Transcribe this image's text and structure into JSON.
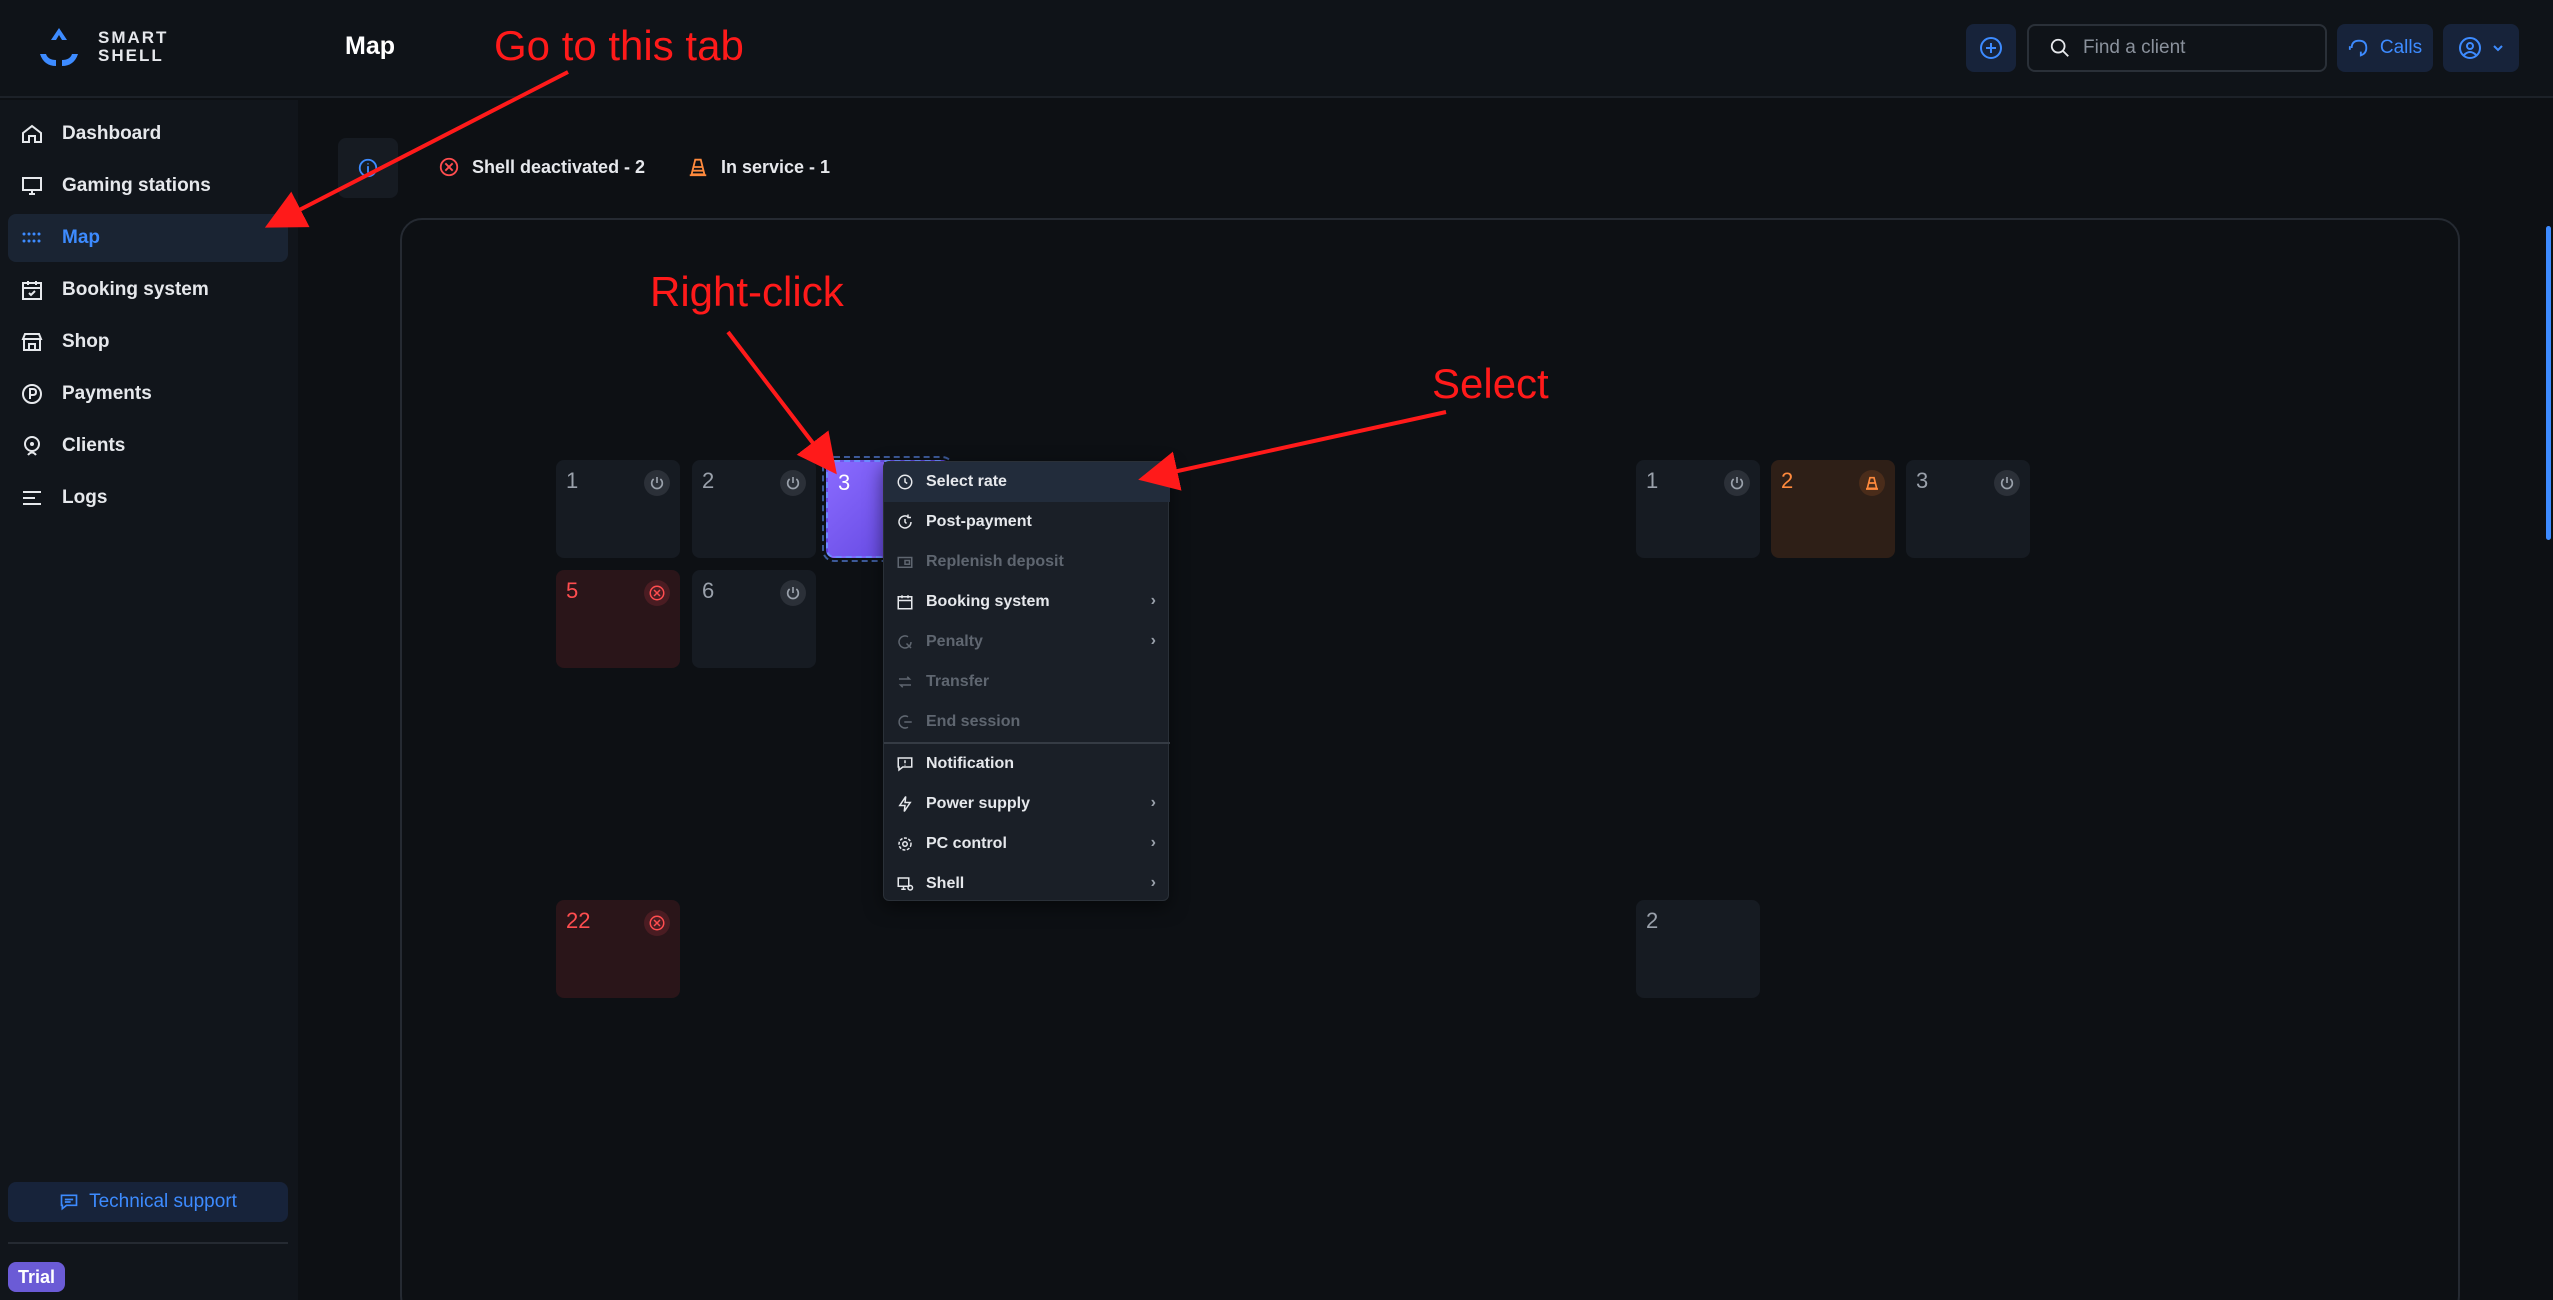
{
  "app": {
    "logo_line1": "SMART",
    "logo_line2": "SHELL",
    "page_title": "Map"
  },
  "header": {
    "search_placeholder": "Find a client",
    "calls_label": "Calls"
  },
  "sidebar": {
    "items": [
      {
        "label": "Dashboard",
        "icon": "home-icon"
      },
      {
        "label": "Gaming stations",
        "icon": "monitor-icon"
      },
      {
        "label": "Map",
        "icon": "grid-dots-icon",
        "active": true
      },
      {
        "label": "Booking system",
        "icon": "calendar-icon"
      },
      {
        "label": "Shop",
        "icon": "store-icon"
      },
      {
        "label": "Payments",
        "icon": "payment-icon"
      },
      {
        "label": "Clients",
        "icon": "user-icon"
      },
      {
        "label": "Logs",
        "icon": "list-icon"
      }
    ],
    "tech_support": "Technical support",
    "trial": "Trial"
  },
  "legend": {
    "deactivated": "Shell deactivated - 2",
    "in_service": "In service - 1"
  },
  "stations": [
    {
      "label": "1",
      "status": "idle"
    },
    {
      "label": "2",
      "status": "idle"
    },
    {
      "label": "3",
      "status": "selected"
    },
    {
      "label": "5",
      "status": "deactivated"
    },
    {
      "label": "6",
      "status": "idle"
    },
    {
      "label": "22",
      "status": "deactivated"
    },
    {
      "label": "1",
      "status": "idle"
    },
    {
      "label": "2",
      "status": "in-service"
    },
    {
      "label": "3",
      "status": "idle"
    },
    {
      "label": "2",
      "status": "empty"
    }
  ],
  "context_menu": {
    "items": [
      {
        "label": "Select rate",
        "enabled": true,
        "submenu": false
      },
      {
        "label": "Post-payment",
        "enabled": true,
        "submenu": false
      },
      {
        "label": "Replenish deposit",
        "enabled": false,
        "submenu": false
      },
      {
        "label": "Booking system",
        "enabled": true,
        "submenu": true
      },
      {
        "label": "Penalty",
        "enabled": false,
        "submenu": true
      },
      {
        "label": "Transfer",
        "enabled": false,
        "submenu": false
      },
      {
        "label": "End session",
        "enabled": false,
        "submenu": false
      },
      {
        "label": "Notification",
        "enabled": true,
        "submenu": false
      },
      {
        "label": "Power supply",
        "enabled": true,
        "submenu": true
      },
      {
        "label": "PC control",
        "enabled": true,
        "submenu": true
      },
      {
        "label": "Shell",
        "enabled": true,
        "submenu": true
      }
    ],
    "chevron": "›"
  },
  "annotations": {
    "go_to_tab": "Go to this tab",
    "right_click": "Right-click",
    "select": "Select",
    "color": "#ff1a1a"
  }
}
